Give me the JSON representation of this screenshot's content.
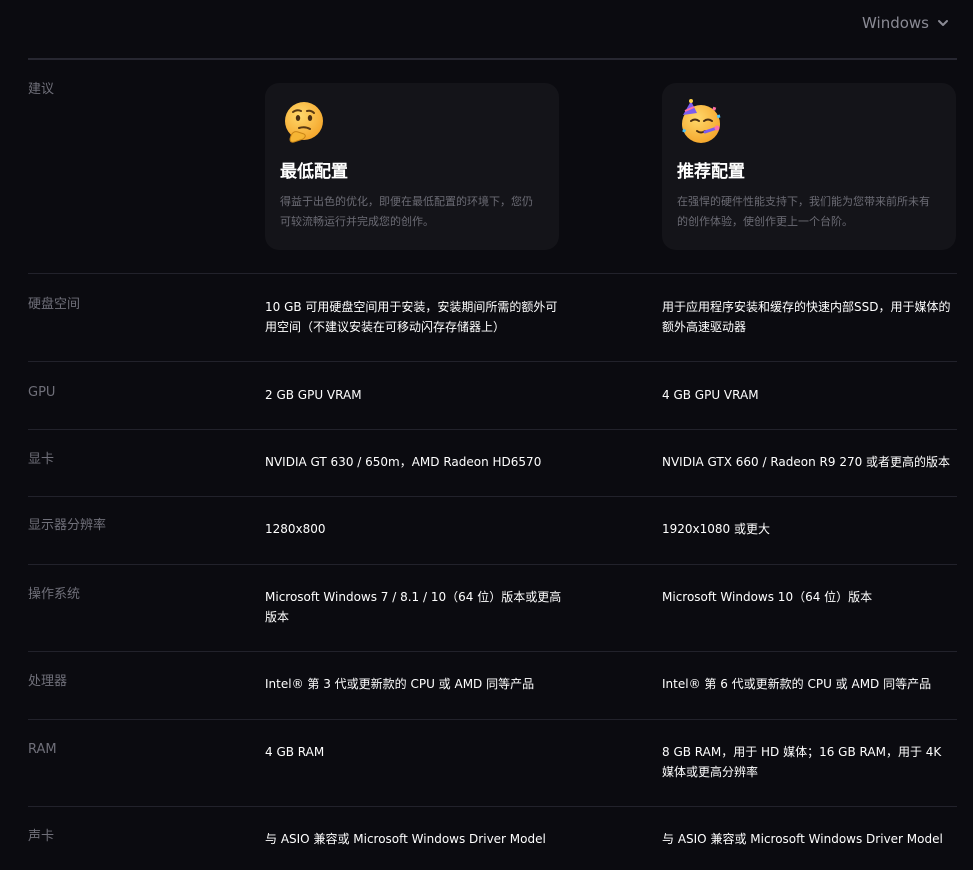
{
  "os_selector": {
    "value": "Windows"
  },
  "header_row": {
    "label": "建议",
    "minimum": {
      "title": "最低配置",
      "description": "得益于出色的优化，即便在最低配置的环境下，您仍可较流畅运行并完成您的创作。"
    },
    "recommended": {
      "title": "推荐配置",
      "description": "在强悍的硬件性能支持下，我们能为您带来前所未有的创作体验，使创作更上一个台阶。"
    }
  },
  "rows": [
    {
      "label": "硬盘空间",
      "minimum": "10 GB 可用硬盘空间用于安装，安装期间所需的额外可用空间（不建议安装在可移动闪存存储器上）",
      "recommended": "用于应用程序安装和缓存的快速内部SSD，用于媒体的额外高速驱动器"
    },
    {
      "label": "GPU",
      "minimum": "2 GB GPU VRAM",
      "recommended": "4 GB GPU VRAM"
    },
    {
      "label": "显卡",
      "minimum": "NVIDIA GT 630 / 650m，AMD Radeon HD6570",
      "recommended": "NVIDIA GTX 660 / Radeon R9 270 或者更高的版本"
    },
    {
      "label": "显示器分辨率",
      "minimum": "1280x800",
      "recommended": "1920x1080 或更大"
    },
    {
      "label": "操作系统",
      "minimum": "Microsoft Windows 7 / 8.1 / 10（64 位）版本或更高版本",
      "recommended": "Microsoft Windows 10（64 位）版本"
    },
    {
      "label": "处理器",
      "minimum": "Intel® 第 3 代或更新款的 CPU 或 AMD 同等产品",
      "recommended": "Intel® 第 6 代或更新款的 CPU 或 AMD 同等产品"
    },
    {
      "label": "RAM",
      "minimum": "4 GB RAM",
      "recommended": "8 GB RAM，用于 HD 媒体；16 GB RAM，用于 4K 媒体或更高分辨率"
    },
    {
      "label": "声卡",
      "minimum": "与 ASIO 兼容或 Microsoft Windows Driver Model",
      "recommended": "与 ASIO 兼容或 Microsoft Windows Driver Model"
    }
  ]
}
